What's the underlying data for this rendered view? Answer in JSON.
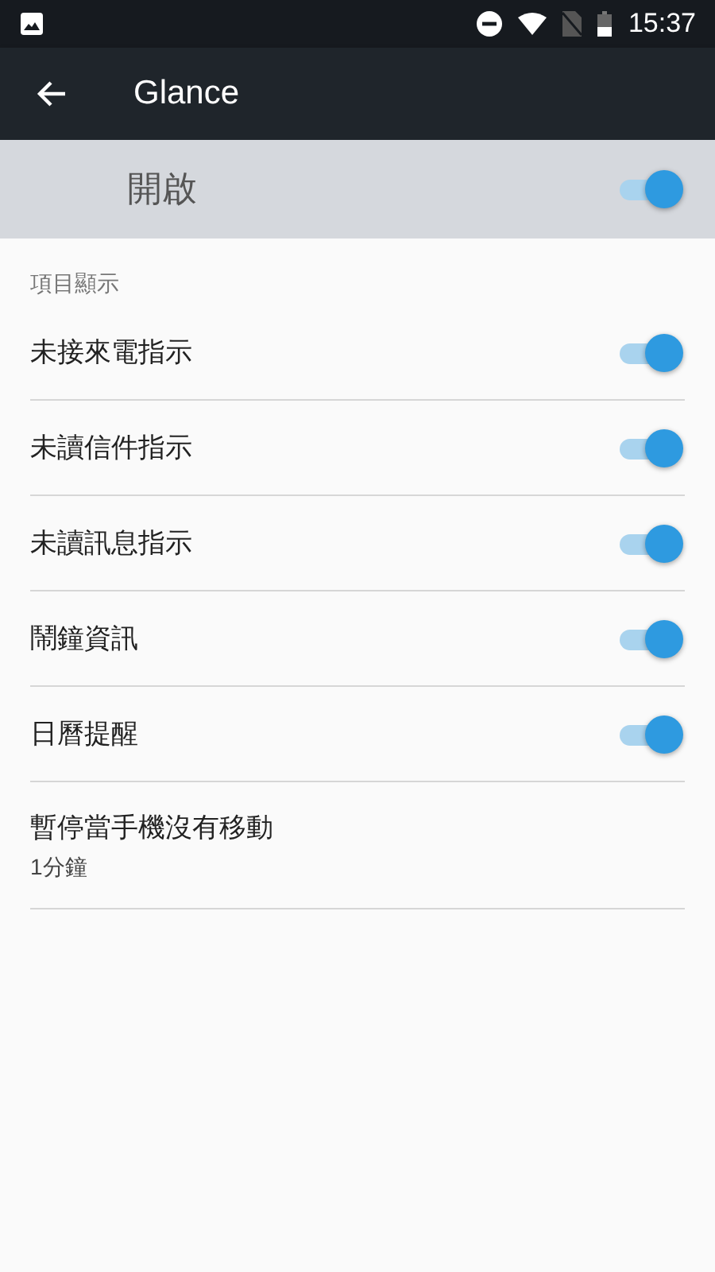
{
  "status_bar": {
    "time": "15:37"
  },
  "app_bar": {
    "title": "Glance"
  },
  "master_switch": {
    "label": "開啟",
    "on": true
  },
  "category": "項目顯示",
  "items": [
    {
      "kind": "switch",
      "label": "未接來電指示",
      "on": true
    },
    {
      "kind": "switch",
      "label": "未讀信件指示",
      "on": true
    },
    {
      "kind": "switch",
      "label": "未讀訊息指示",
      "on": true
    },
    {
      "kind": "switch",
      "label": "鬧鐘資訊",
      "on": true
    },
    {
      "kind": "switch",
      "label": "日曆提醒",
      "on": true
    },
    {
      "kind": "value",
      "label": "暫停當手機沒有移動",
      "summary": "1分鐘"
    }
  ]
}
